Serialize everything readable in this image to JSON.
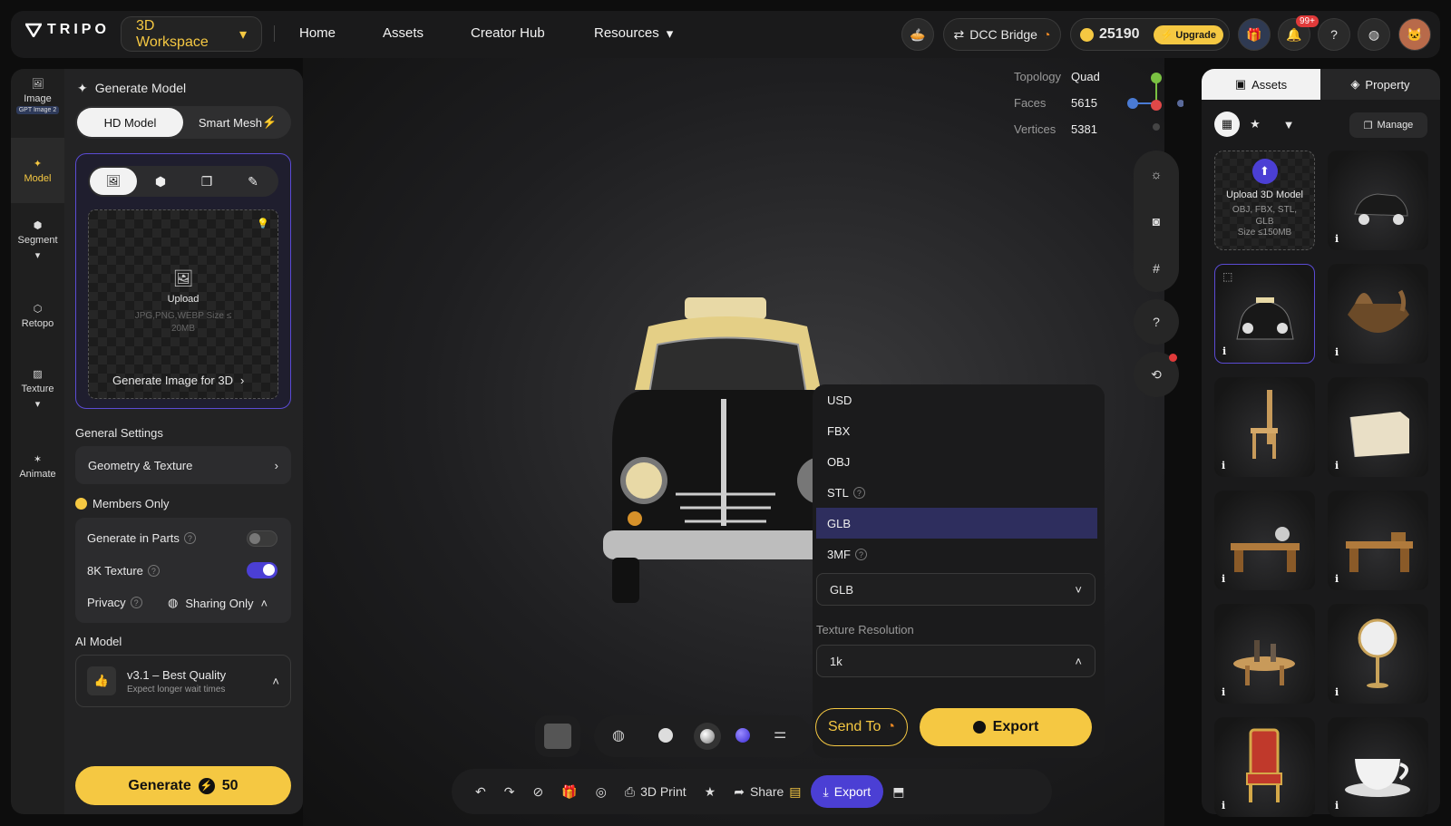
{
  "header": {
    "logo": "TRIPO",
    "workspace": "3D Workspace",
    "nav": [
      "Home",
      "Assets",
      "Creator Hub",
      "Resources"
    ],
    "dcc_bridge": "DCC Bridge",
    "credits": "25190",
    "upgrade": "Upgrade",
    "notif_badge": "99+"
  },
  "rail": {
    "items": [
      {
        "label": "Image",
        "tag": "GPT Image 2"
      },
      {
        "label": "Model"
      },
      {
        "label": "Segment"
      },
      {
        "label": "Retopo"
      },
      {
        "label": "Texture"
      },
      {
        "label": "Animate"
      }
    ]
  },
  "panel": {
    "title": "Generate Model",
    "tab_hd": "HD Model",
    "tab_smart": "Smart Mesh",
    "upload": "Upload",
    "upload_formats": "JPG,PNG,WEBP Size ≤ 20MB",
    "generate_image": "Generate Image for 3D",
    "general_settings": "General Settings",
    "geometry": "Geometry & Texture",
    "members_only": "Members Only",
    "gen_parts": "Generate in Parts",
    "tex8k": "8K Texture",
    "privacy": "Privacy",
    "sharing": "Sharing Only",
    "ai_model": "AI Model",
    "model_name": "v3.1 – Best Quality",
    "model_sub": "Expect longer wait times",
    "generate": "Generate",
    "generate_cost": "50"
  },
  "stats": {
    "topology_label": "Topology",
    "topology": "Quad",
    "faces_label": "Faces",
    "faces": "5615",
    "vertices_label": "Vertices",
    "vertices": "5381"
  },
  "export_menu": {
    "options": [
      "USD",
      "FBX",
      "OBJ",
      "STL",
      "GLB",
      "3MF"
    ],
    "selected": "GLB",
    "format_value": "GLB",
    "texture_label": "Texture Resolution",
    "texture_value": "1k",
    "send_to": "Send To",
    "export": "Export"
  },
  "bottombar": {
    "print": "3D Print",
    "share": "Share",
    "export": "Export"
  },
  "right": {
    "tab_assets": "Assets",
    "tab_property": "Property",
    "manage": "Manage",
    "upload_title": "Upload 3D Model",
    "upload_formats": "OBJ, FBX, STL, GLB",
    "upload_size": "Size ≤150MB",
    "cards": [
      "taxi-small",
      "taxi",
      "boat",
      "chair",
      "chest",
      "desk-globe",
      "desk",
      "table-bottles",
      "mirror",
      "throne",
      "teacup"
    ]
  },
  "colors": {
    "accent": "#f5c842",
    "purple": "#5b4bd4",
    "bg": "#0d0d0d"
  }
}
